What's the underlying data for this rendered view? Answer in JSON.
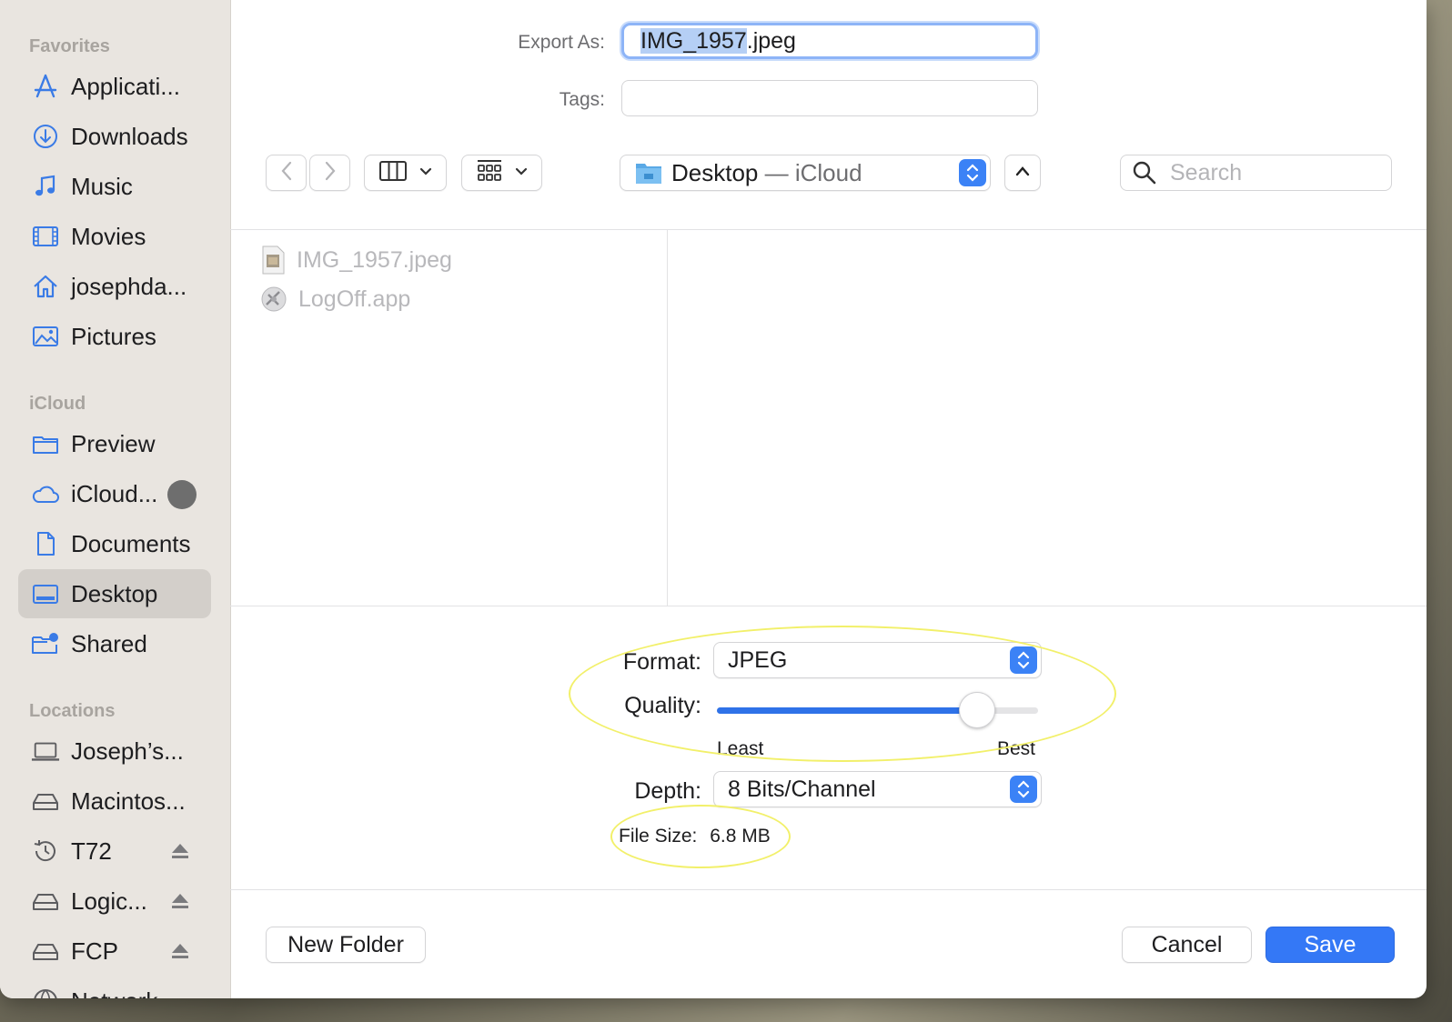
{
  "sidebar": {
    "sections": [
      {
        "title": "Favorites",
        "items": [
          {
            "label": "Applicati...",
            "icon": "applications-icon"
          },
          {
            "label": "Downloads",
            "icon": "downloads-icon"
          },
          {
            "label": "Music",
            "icon": "music-icon"
          },
          {
            "label": "Movies",
            "icon": "movies-icon"
          },
          {
            "label": "josephda...",
            "icon": "home-icon"
          },
          {
            "label": "Pictures",
            "icon": "pictures-icon"
          }
        ]
      },
      {
        "title": "iCloud",
        "items": [
          {
            "label": "Preview",
            "icon": "folder-icon"
          },
          {
            "label": "iCloud...",
            "icon": "cloud-icon"
          },
          {
            "label": "Documents",
            "icon": "document-icon"
          },
          {
            "label": "Desktop",
            "icon": "desktop-icon",
            "selected": true
          },
          {
            "label": "Shared",
            "icon": "shared-folder-icon"
          }
        ]
      },
      {
        "title": "Locations",
        "items": [
          {
            "label": "Joseph’s...",
            "icon": "laptop-icon"
          },
          {
            "label": "Macintos...",
            "icon": "drive-icon"
          },
          {
            "label": "T72",
            "icon": "time-machine-icon"
          },
          {
            "label": "Logic...",
            "icon": "drive-icon"
          },
          {
            "label": "FCP",
            "icon": "drive-icon"
          },
          {
            "label": "Network",
            "icon": "network-icon"
          }
        ]
      }
    ]
  },
  "form": {
    "export_as_label": "Export As:",
    "filename_selected": "IMG_1957",
    "filename_ext": ".jpeg",
    "tags_label": "Tags:",
    "tags_value": ""
  },
  "toolbar": {
    "location_name": "Desktop",
    "location_separator": " — ",
    "location_cloud": "iCloud",
    "search_placeholder": "Search"
  },
  "files": [
    {
      "name": "IMG_1957.jpeg",
      "icon": "jpeg-file-icon"
    },
    {
      "name": "LogOff.app",
      "icon": "app-icon"
    }
  ],
  "options": {
    "format_label": "Format:",
    "format_value": "JPEG",
    "quality_label": "Quality:",
    "quality_fraction": 0.81,
    "quality_min_label": "Least",
    "quality_max_label": "Best",
    "depth_label": "Depth:",
    "depth_value": "8 Bits/Channel",
    "file_size_label": "File Size:",
    "file_size_value": "6.8 MB"
  },
  "buttons": {
    "new_folder": "New Folder",
    "cancel": "Cancel",
    "save": "Save"
  },
  "colors": {
    "accent": "#3478f6",
    "annotation": "#f2f06a"
  }
}
